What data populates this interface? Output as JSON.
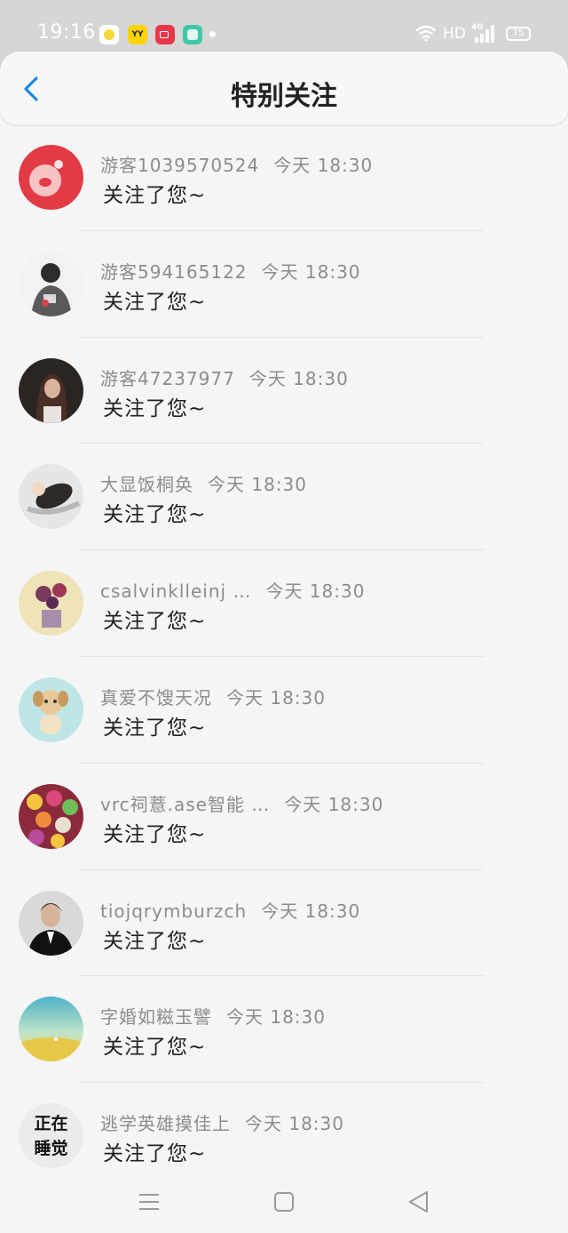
{
  "status_bar": {
    "time": "19:16",
    "network": "HD",
    "network_type": "4G",
    "battery": "75",
    "yy_icon_label": "YY"
  },
  "header": {
    "title": "特别关注"
  },
  "items": [
    {
      "username": "游客1039570524",
      "time": "今天 18:30",
      "message": "关注了您~"
    },
    {
      "username": "游客594165122",
      "time": "今天 18:30",
      "message": "关注了您~"
    },
    {
      "username": "游客47237977",
      "time": "今天 18:30",
      "message": "关注了您~"
    },
    {
      "username": "大显饭桐奂",
      "time": "今天 18:30",
      "message": "关注了您~"
    },
    {
      "username": "csalvinklleinj …",
      "time": "今天 18:30",
      "message": "关注了您~"
    },
    {
      "username": "真爱不馊天况",
      "time": "今天 18:30",
      "message": "关注了您~"
    },
    {
      "username": "vrc祠薏.ase智能 …",
      "time": "今天 18:30",
      "message": "关注了您~"
    },
    {
      "username": "tiojqrymburzch",
      "time": "今天 18:30",
      "message": "关注了您~"
    },
    {
      "username": "字婚如糍玉譬",
      "time": "今天 18:30",
      "message": "关注了您~"
    },
    {
      "username": "逃学英雄摸佳上",
      "time": "今天 18:30",
      "message": "关注了您~",
      "avatar_text": [
        "正在",
        "睡觉"
      ]
    }
  ],
  "colors": {
    "accent": "#1e88e5",
    "status_bar_bg": "#d6d6d6",
    "page_bg": "#f5f5f5"
  },
  "icons": {
    "back": "chevron-left-icon",
    "menu": "menu-icon",
    "home": "home-square-icon",
    "back_nav": "triangle-back-icon"
  }
}
